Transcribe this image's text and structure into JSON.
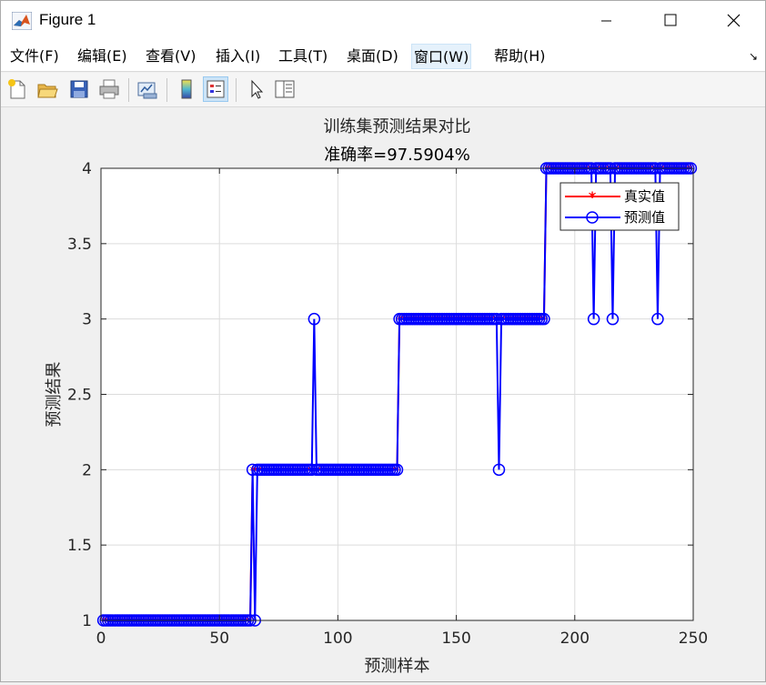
{
  "window": {
    "title": "Figure 1",
    "controls": {
      "minimize": "minimize",
      "maximize": "maximize",
      "close": "close"
    }
  },
  "menu": {
    "items": [
      {
        "label": "文件(F)"
      },
      {
        "label": "编辑(E)"
      },
      {
        "label": "查看(V)"
      },
      {
        "label": "插入(I)"
      },
      {
        "label": "工具(T)"
      },
      {
        "label": "桌面(D)"
      },
      {
        "label": "窗口(W)"
      },
      {
        "label": "帮助(H)"
      }
    ],
    "active_index": 6
  },
  "toolbar": {
    "icons": [
      "new-figure-icon",
      "open-file-icon",
      "save-icon",
      "print-icon",
      "link-plot-icon",
      "colorbar-icon",
      "legend-icon",
      "pointer-icon",
      "property-inspector-icon"
    ]
  },
  "colors": {
    "true_series": "#ff0000",
    "pred_series": "#0000ff",
    "grid": "#dcdcdc",
    "axes_bg": "#ffffff"
  },
  "chart_data": {
    "type": "line",
    "title": "训练集预测结果对比",
    "subtitle": "准确率=97.5904%",
    "xlabel": "预测样本",
    "ylabel": "预测结果",
    "xlim": [
      0,
      250
    ],
    "ylim": [
      1,
      4
    ],
    "xticks": [
      "0",
      "50",
      "100",
      "150",
      "200",
      "250"
    ],
    "yticks": [
      "1",
      "1.5",
      "2",
      "2.5",
      "3",
      "3.5",
      "4"
    ],
    "grid": true,
    "legend_position": "top-right",
    "series": [
      {
        "name": "真实值",
        "marker": "asterisk",
        "segments": [
          {
            "from": 1,
            "to": 63,
            "value": 1
          },
          {
            "from": 64,
            "to": 125,
            "value": 2
          },
          {
            "from": 126,
            "to": 187,
            "value": 3
          },
          {
            "from": 188,
            "to": 249,
            "value": 4
          }
        ]
      },
      {
        "name": "预测值",
        "marker": "circle",
        "segments": [
          {
            "from": 1,
            "to": 63,
            "value": 1
          },
          {
            "from": 64,
            "to": 125,
            "value": 2
          },
          {
            "from": 126,
            "to": 187,
            "value": 3
          },
          {
            "from": 188,
            "to": 249,
            "value": 4
          }
        ],
        "deviations": [
          {
            "x": 64,
            "value": 2
          },
          {
            "x": 65,
            "value": 1
          },
          {
            "x": 90,
            "value": 3
          },
          {
            "x": 168,
            "value": 2
          },
          {
            "x": 208,
            "value": 3
          },
          {
            "x": 216,
            "value": 3
          },
          {
            "x": 235,
            "value": 3
          }
        ]
      }
    ]
  }
}
